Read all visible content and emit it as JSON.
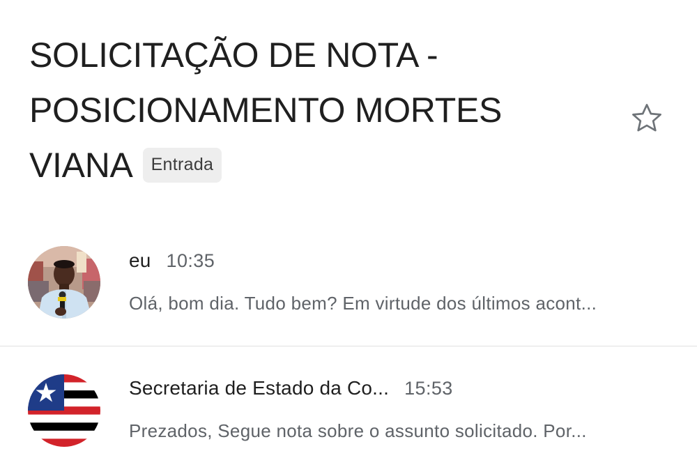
{
  "email": {
    "subject": "SOLICITAÇÃO DE NOTA - POSICIONAMENTO MORTES VIANA",
    "label": "Entrada"
  },
  "icons": {
    "star": "star-outline-icon"
  },
  "colors": {
    "flag_red": "#d2232a",
    "flag_blue": "#1f3c88",
    "flag_black": "#000000",
    "label_bg": "#eeeeee",
    "divider": "#e0e0e0",
    "secondary_text": "#5f6368"
  },
  "messages": [
    {
      "sender": "eu",
      "time": "10:35",
      "snippet": "Olá, bom dia. Tudo bem? Em virtude dos últimos acont..."
    },
    {
      "sender": "Secretaria de Estado da Co...",
      "time": "15:53",
      "snippet": "Prezados, Segue nota sobre o assunto solicitado. Por..."
    }
  ]
}
